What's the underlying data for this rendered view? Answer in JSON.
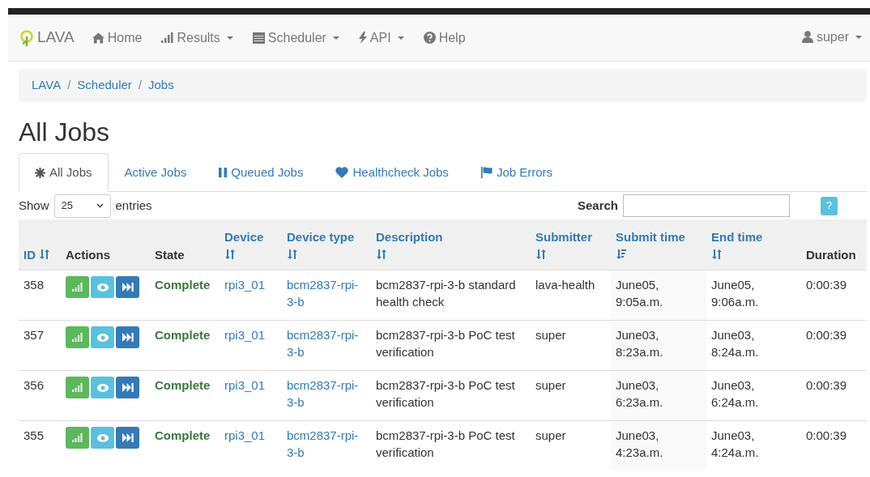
{
  "navbar": {
    "brand": "LAVA",
    "items": [
      {
        "kind": "home",
        "label": "Home",
        "dropdown": false
      },
      {
        "kind": "chart",
        "label": "Results",
        "dropdown": true
      },
      {
        "kind": "calendar",
        "label": "Scheduler",
        "dropdown": true
      },
      {
        "kind": "bolt",
        "label": "API",
        "dropdown": true
      },
      {
        "kind": "question",
        "label": "Help",
        "dropdown": false
      }
    ],
    "user": {
      "label": "super",
      "dropdown": true
    }
  },
  "breadcrumb": {
    "separator": "/",
    "items": [
      "LAVA",
      "Scheduler",
      "Jobs"
    ]
  },
  "heading": "All Jobs",
  "tabs": [
    {
      "kind": "asterisk",
      "label": "All Jobs",
      "selected": true
    },
    {
      "kind": "plain",
      "label": "Active Jobs",
      "selected": false
    },
    {
      "kind": "pause",
      "label": "Queued Jobs",
      "selected": false
    },
    {
      "kind": "heart",
      "label": "Healthcheck Jobs",
      "selected": false
    },
    {
      "kind": "flag",
      "label": "Job Errors",
      "selected": false
    }
  ],
  "length": {
    "before": "Show",
    "value": "25",
    "after": "entries"
  },
  "search": {
    "label": "Search"
  },
  "help_button": "?",
  "table": {
    "columns": [
      {
        "label": "ID",
        "sortable": true,
        "sorted_descending": false
      },
      {
        "label": "Actions",
        "sortable": false,
        "sorted_descending": false
      },
      {
        "label": "State",
        "sortable": false,
        "sorted_descending": false
      },
      {
        "label": "Device",
        "sortable": true,
        "sorted_descending": false
      },
      {
        "label": "Device type",
        "sortable": true,
        "sorted_descending": false
      },
      {
        "label": "Description",
        "sortable": true,
        "sorted_descending": false
      },
      {
        "label": "Submitter",
        "sortable": true,
        "sorted_descending": false
      },
      {
        "label": "Submit time",
        "sortable": true,
        "sorted_descending": true
      },
      {
        "label": "End time",
        "sortable": true,
        "sorted_descending": false
      },
      {
        "label": "Duration",
        "sortable": false,
        "sorted_descending": false
      }
    ],
    "rows": [
      {
        "id": "358",
        "state": "Complete",
        "device": "rpi3_01",
        "device_type": "bcm2837-rpi-3-b",
        "description": "bcm2837-rpi-3-b standard health check",
        "submitter": "lava-health",
        "submit_time": "June05, 9:05a.m.",
        "end_time": "June05, 9:06a.m.",
        "duration": "0:00:39"
      },
      {
        "id": "357",
        "state": "Complete",
        "device": "rpi3_01",
        "device_type": "bcm2837-rpi-3-b",
        "description": "bcm2837-rpi-3-b PoC test verification",
        "submitter": "super",
        "submit_time": "June03, 8:23a.m.",
        "end_time": "June03, 8:24a.m.",
        "duration": "0:00:39"
      },
      {
        "id": "356",
        "state": "Complete",
        "device": "rpi3_01",
        "device_type": "bcm2837-rpi-3-b",
        "description": "bcm2837-rpi-3-b PoC test verification",
        "submitter": "super",
        "submit_time": "June03, 6:23a.m.",
        "end_time": "June03, 6:24a.m.",
        "duration": "0:00:39"
      },
      {
        "id": "355",
        "state": "Complete",
        "device": "rpi3_01",
        "device_type": "bcm2837-rpi-3-b",
        "description": "bcm2837-rpi-3-b PoC test verification",
        "submitter": "super",
        "submit_time": "June03, 4:23a.m.",
        "end_time": "June03, 4:24a.m.",
        "duration": "0:00:39"
      }
    ]
  }
}
